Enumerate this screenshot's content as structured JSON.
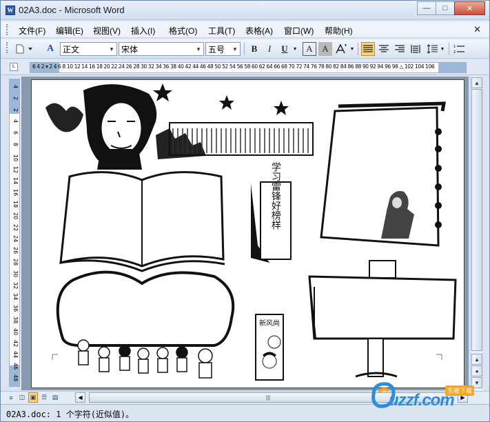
{
  "window": {
    "title": "02A3.doc - Microsoft Word",
    "app_icon": "W",
    "minimize_icon": "—",
    "maximize_icon": "□",
    "close_icon": "✕"
  },
  "menubar": {
    "items": [
      {
        "label": "文件(F)"
      },
      {
        "label": "编辑(E)"
      },
      {
        "label": "视图(V)"
      },
      {
        "label": "插入(I)"
      },
      {
        "label": "格式(O)"
      },
      {
        "label": "工具(T)"
      },
      {
        "label": "表格(A)"
      },
      {
        "label": "窗口(W)"
      },
      {
        "label": "帮助(H)"
      }
    ],
    "close_icon": "✕"
  },
  "toolbar": {
    "style_icon_label": "A",
    "style_value": "正文",
    "font_value": "宋体",
    "size_value": "五号",
    "bold": "B",
    "italic": "I",
    "underline": "U",
    "char_border": "A",
    "char_shading": "A",
    "accent_color": "#fbd47a"
  },
  "ruler": {
    "horizontal_labels": "6 4 2 ▾ 2 4 6 8 10 12 14 16 18 20 22 24 26 28 30 32 34 36 38 40 42 44 46 48 50 52 54 56 58 60 62 64 66 68 70 72 74 76 78 80 82 84 86 88 90 92 94 96 98 △ 102 104 106",
    "vertical_labels": [
      "4",
      "2",
      "2",
      "4",
      "6",
      "8",
      "10",
      "12",
      "14",
      "16",
      "18",
      "20",
      "22",
      "24",
      "26",
      "28",
      "30",
      "32",
      "34",
      "36",
      "38",
      "40",
      "42",
      "44",
      "46",
      "48"
    ]
  },
  "statusbar": {
    "text": "02A3.doc: 1 个字符(近似值)。"
  },
  "document": {
    "banner_poster_text": "学习雷锋好榜样",
    "small_poster_text": "新风尚"
  },
  "watermark": {
    "tag": "东坡下载",
    "text": "uzzf.com"
  }
}
